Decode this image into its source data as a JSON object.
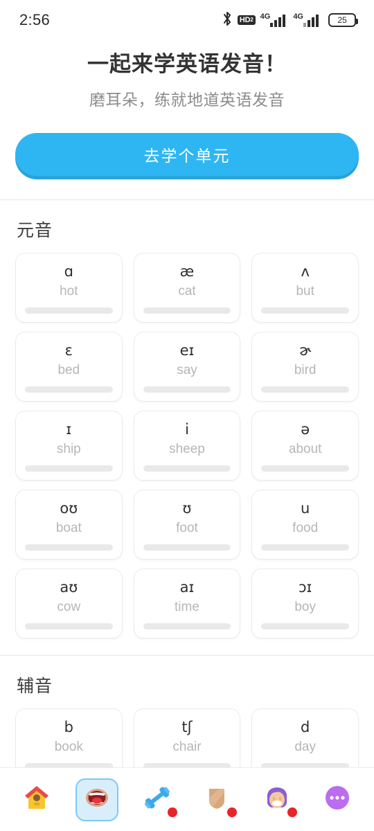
{
  "statusbar": {
    "time": "2:56",
    "bluetooth_icon": "bluetooth-icon",
    "hd_label": "HD",
    "hd_sub": "2",
    "network_label_1": "4G",
    "network_label_2": "4G",
    "battery_level": "25"
  },
  "hero": {
    "title": "一起来学英语发音！",
    "subtitle": "磨耳朵，练就地道英语发音",
    "cta_label": "去学个单元"
  },
  "theme": {
    "accent": "#2eb6f2",
    "accent_shadow": "#28a3db",
    "card_border": "#eaeaea",
    "word_gray": "#b6b6b6",
    "badge_red": "#e8232a",
    "nav_selected_bg": "#d9eefb",
    "nav_selected_border": "#7ec9f2"
  },
  "sections": [
    {
      "title": "元音",
      "cards": [
        {
          "ipa": "ɑ",
          "word": "hot",
          "progress": 0
        },
        {
          "ipa": "æ",
          "word": "cat",
          "progress": 0
        },
        {
          "ipa": "ʌ",
          "word": "but",
          "progress": 0
        },
        {
          "ipa": "ɛ",
          "word": "bed",
          "progress": 0
        },
        {
          "ipa": "eɪ",
          "word": "say",
          "progress": 0
        },
        {
          "ipa": "ɚ",
          "word": "bird",
          "progress": 0
        },
        {
          "ipa": "ɪ",
          "word": "ship",
          "progress": 0
        },
        {
          "ipa": "i",
          "word": "sheep",
          "progress": 0
        },
        {
          "ipa": "ə",
          "word": "about",
          "progress": 0
        },
        {
          "ipa": "oʊ",
          "word": "boat",
          "progress": 0
        },
        {
          "ipa": "ʊ",
          "word": "foot",
          "progress": 0
        },
        {
          "ipa": "u",
          "word": "food",
          "progress": 0
        },
        {
          "ipa": "aʊ",
          "word": "cow",
          "progress": 0
        },
        {
          "ipa": "aɪ",
          "word": "time",
          "progress": 0
        },
        {
          "ipa": "ɔɪ",
          "word": "boy",
          "progress": 0
        }
      ]
    },
    {
      "title": "辅音",
      "cards": [
        {
          "ipa": "b",
          "word": "book",
          "progress": 0
        },
        {
          "ipa": "tʃ",
          "word": "chair",
          "progress": 0
        },
        {
          "ipa": "d",
          "word": "day",
          "progress": 0
        }
      ]
    }
  ],
  "bottom_nav": [
    {
      "name": "nav-home",
      "icon": "birdhouse-icon",
      "selected": false,
      "badge": false
    },
    {
      "name": "nav-phonics",
      "icon": "mouth-icon",
      "selected": true,
      "badge": false
    },
    {
      "name": "nav-practice",
      "icon": "dumbbell-icon",
      "selected": false,
      "badge": true
    },
    {
      "name": "nav-library",
      "icon": "shield-icon",
      "selected": false,
      "badge": true
    },
    {
      "name": "nav-profile",
      "icon": "avatar-icon",
      "selected": false,
      "badge": true
    },
    {
      "name": "nav-more",
      "icon": "more-dots-icon",
      "selected": false,
      "badge": false
    }
  ]
}
